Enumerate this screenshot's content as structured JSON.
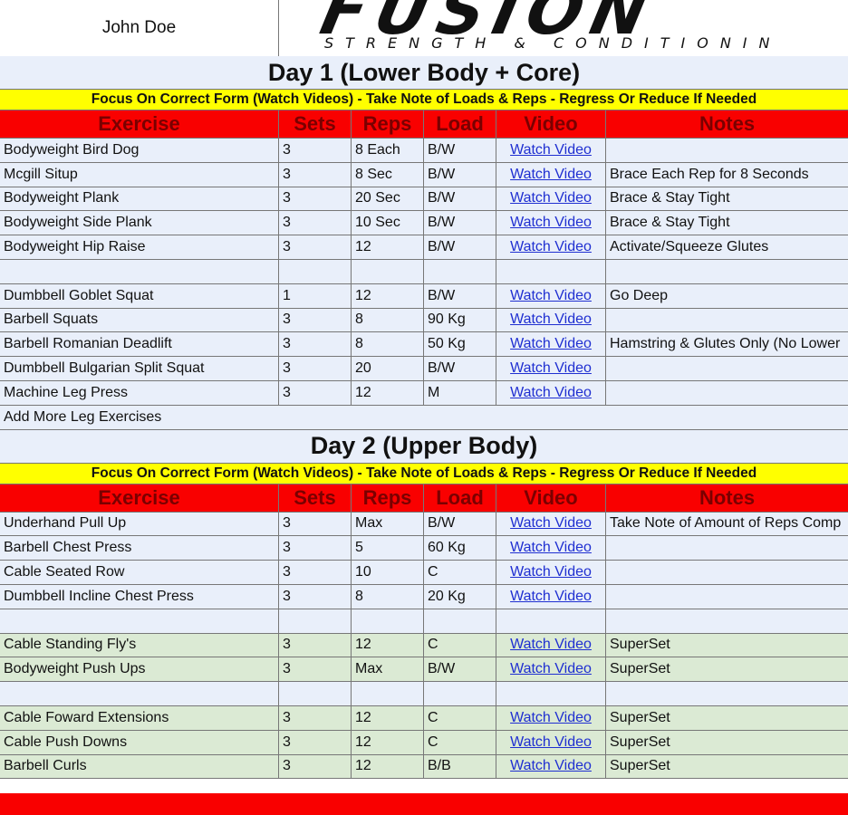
{
  "client_name": "John Doe",
  "logo": {
    "main": "FUSION",
    "sub": "STRENGTH & CONDITIONIN"
  },
  "columns": [
    "Exercise",
    "Sets",
    "Reps",
    "Load",
    "Video",
    "Notes"
  ],
  "day1": {
    "title": "Day 1 (Lower Body + Core)",
    "focus": "Focus On Correct Form (Watch Videos) - Take Note of Loads & Reps - Regress Or Reduce If Needed",
    "rows": [
      {
        "exercise": "Bodyweight Bird Dog",
        "sets": "3",
        "reps": "8 Each",
        "load": "B/W",
        "video": "Watch Video",
        "notes": ""
      },
      {
        "exercise": "Mcgill Situp",
        "sets": "3",
        "reps": "8 Sec",
        "load": "B/W",
        "video": "Watch Video",
        "notes": "Brace Each Rep for 8 Seconds"
      },
      {
        "exercise": "Bodyweight Plank",
        "sets": "3",
        "reps": "20 Sec",
        "load": "B/W",
        "video": "Watch Video",
        "notes": "Brace & Stay Tight"
      },
      {
        "exercise": "Bodyweight Side Plank",
        "sets": "3",
        "reps": "10 Sec",
        "load": "B/W",
        "video": "Watch Video",
        "notes": "Brace & Stay Tight"
      },
      {
        "exercise": "Bodyweight Hip Raise",
        "sets": "3",
        "reps": "12",
        "load": "B/W",
        "video": "Watch Video",
        "notes": "Activate/Squeeze Glutes"
      },
      {
        "exercise": "",
        "sets": "",
        "reps": "",
        "load": "",
        "video": "",
        "notes": ""
      },
      {
        "exercise": "Dumbbell Goblet Squat",
        "sets": "1",
        "reps": "12",
        "load": "B/W",
        "video": "Watch Video",
        "notes": "Go Deep"
      },
      {
        "exercise": "Barbell Squats",
        "sets": "3",
        "reps": "8",
        "load": "90 Kg",
        "video": "Watch Video",
        "notes": ""
      },
      {
        "exercise": "Barbell Romanian Deadlift",
        "sets": "3",
        "reps": "8",
        "load": "50 Kg",
        "video": "Watch Video",
        "notes": "Hamstring & Glutes Only (No Lower"
      },
      {
        "exercise": "Dumbbell Bulgarian Split Squat",
        "sets": "3",
        "reps": "20",
        "load": "B/W",
        "video": "Watch Video",
        "notes": ""
      },
      {
        "exercise": "Machine Leg Press",
        "sets": "3",
        "reps": "12",
        "load": "M",
        "video": "Watch Video",
        "notes": ""
      }
    ],
    "add_more": "Add More Leg Exercises"
  },
  "day2": {
    "title": "Day 2 (Upper Body)",
    "focus": "Focus On Correct Form (Watch Videos) - Take Note of Loads & Reps - Regress Or Reduce If Needed",
    "rows": [
      {
        "exercise": "Underhand Pull Up",
        "sets": "3",
        "reps": "Max",
        "load": "B/W",
        "video": "Watch Video",
        "notes": "Take Note of Amount of Reps Comp",
        "style": "blue"
      },
      {
        "exercise": "Barbell Chest Press",
        "sets": "3",
        "reps": "5",
        "load": "60 Kg",
        "video": "Watch Video",
        "notes": "",
        "style": "blue"
      },
      {
        "exercise": "Cable Seated Row",
        "sets": "3",
        "reps": "10",
        "load": "C",
        "video": "Watch Video",
        "notes": "",
        "style": "blue"
      },
      {
        "exercise": "Dumbbell Incline Chest Press",
        "sets": "3",
        "reps": "8",
        "load": "20 Kg",
        "video": "Watch Video",
        "notes": "",
        "style": "blue"
      },
      {
        "exercise": "",
        "sets": "",
        "reps": "",
        "load": "",
        "video": "",
        "notes": "",
        "style": "blue"
      },
      {
        "exercise": "Cable Standing Fly's",
        "sets": "3",
        "reps": "12",
        "load": "C",
        "video": "Watch Video",
        "notes": "SuperSet",
        "style": "green"
      },
      {
        "exercise": "Bodyweight Push Ups",
        "sets": "3",
        "reps": "Max",
        "load": "B/W",
        "video": "Watch Video",
        "notes": "SuperSet",
        "style": "green"
      },
      {
        "exercise": "",
        "sets": "",
        "reps": "",
        "load": "",
        "video": "",
        "notes": "",
        "style": "blue"
      },
      {
        "exercise": "Cable Foward Extensions",
        "sets": "3",
        "reps": "12",
        "load": "C",
        "video": "Watch Video",
        "notes": "SuperSet",
        "style": "green"
      },
      {
        "exercise": "Cable Push Downs",
        "sets": "3",
        "reps": "12",
        "load": "C",
        "video": "Watch Video",
        "notes": "SuperSet",
        "style": "green"
      },
      {
        "exercise": "Barbell Curls",
        "sets": "3",
        "reps": "12",
        "load": "B/B",
        "video": "Watch Video",
        "notes": "SuperSet",
        "style": "green"
      }
    ]
  },
  "colors": {
    "header_red": "#f90000",
    "header_text": "#7a0000",
    "focus_yellow": "#ffff00",
    "row_blue": "#e9effa",
    "row_green": "#dbead4",
    "link_blue": "#1f2fd1"
  }
}
